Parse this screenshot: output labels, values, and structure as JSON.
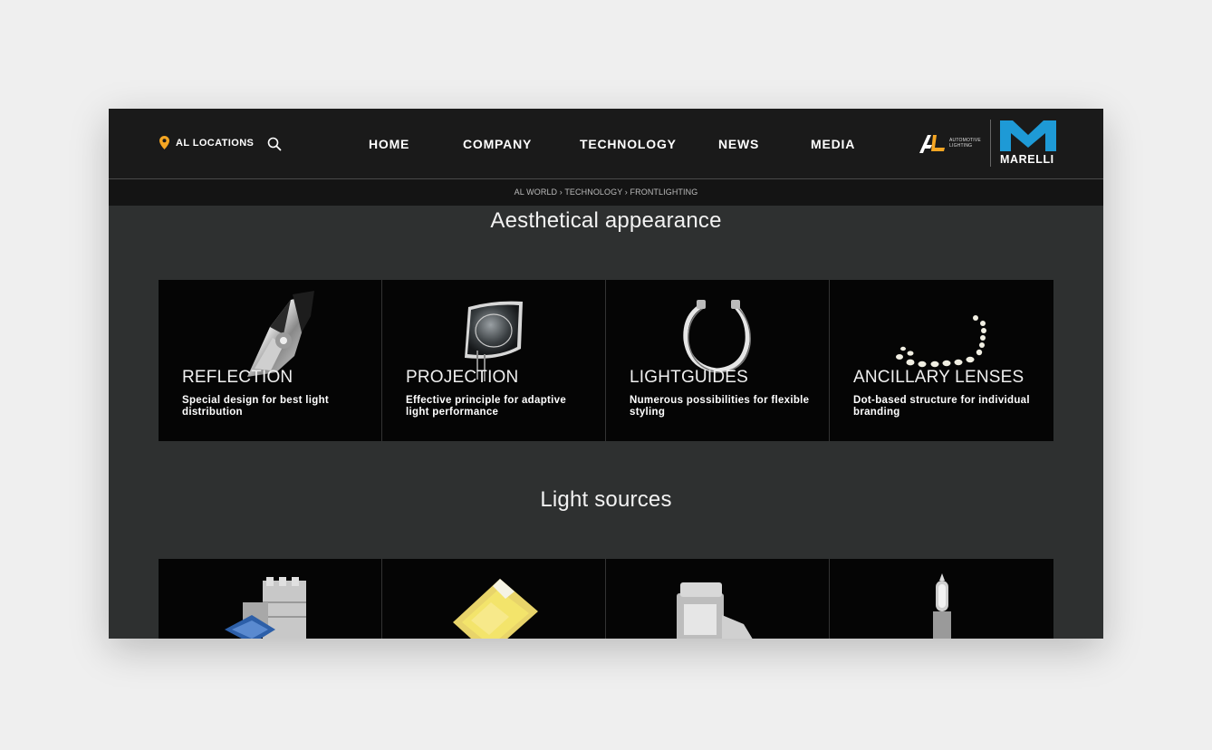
{
  "header": {
    "locations_label": "AL LOCATIONS",
    "nav": [
      "HOME",
      "COMPANY",
      "TECHNOLOGY",
      "NEWS",
      "MEDIA"
    ],
    "al_logo_subtext": [
      "AUTOMOTIVE",
      "LIGHTING"
    ],
    "brand_name": "MARELLI"
  },
  "breadcrumb": [
    "AL WORLD",
    "TECHNOLOGY",
    "FRONTLIGHTING"
  ],
  "breadcrumb_separator": "›",
  "sections": [
    {
      "title": "Aesthetical appearance",
      "cards": [
        {
          "title": "REFLECTION",
          "description": "Special design for best light distribution",
          "image": "headlamp-reflector"
        },
        {
          "title": "PROJECTION",
          "description": "Effective principle for adaptive light performance",
          "image": "projector-lens"
        },
        {
          "title": "LIGHTGUIDES",
          "description": "Numerous possibilities for flexible styling",
          "image": "light-guide-ring"
        },
        {
          "title": "ANCILLARY LENSES",
          "description": "Dot-based structure for individual branding",
          "image": "led-dot-array"
        }
      ]
    },
    {
      "title": "Light sources",
      "cards": [
        {
          "image": "laser-module"
        },
        {
          "image": "led-chip"
        },
        {
          "image": "xenon-bulb"
        },
        {
          "image": "halogen-bulb"
        }
      ]
    }
  ],
  "colors": {
    "background": "#efefef",
    "header": "#1a1a1a",
    "page": "#2e3030",
    "card": "#050505",
    "accent_orange": "#f5a623",
    "marelli_blue": "#1e9ad6"
  }
}
